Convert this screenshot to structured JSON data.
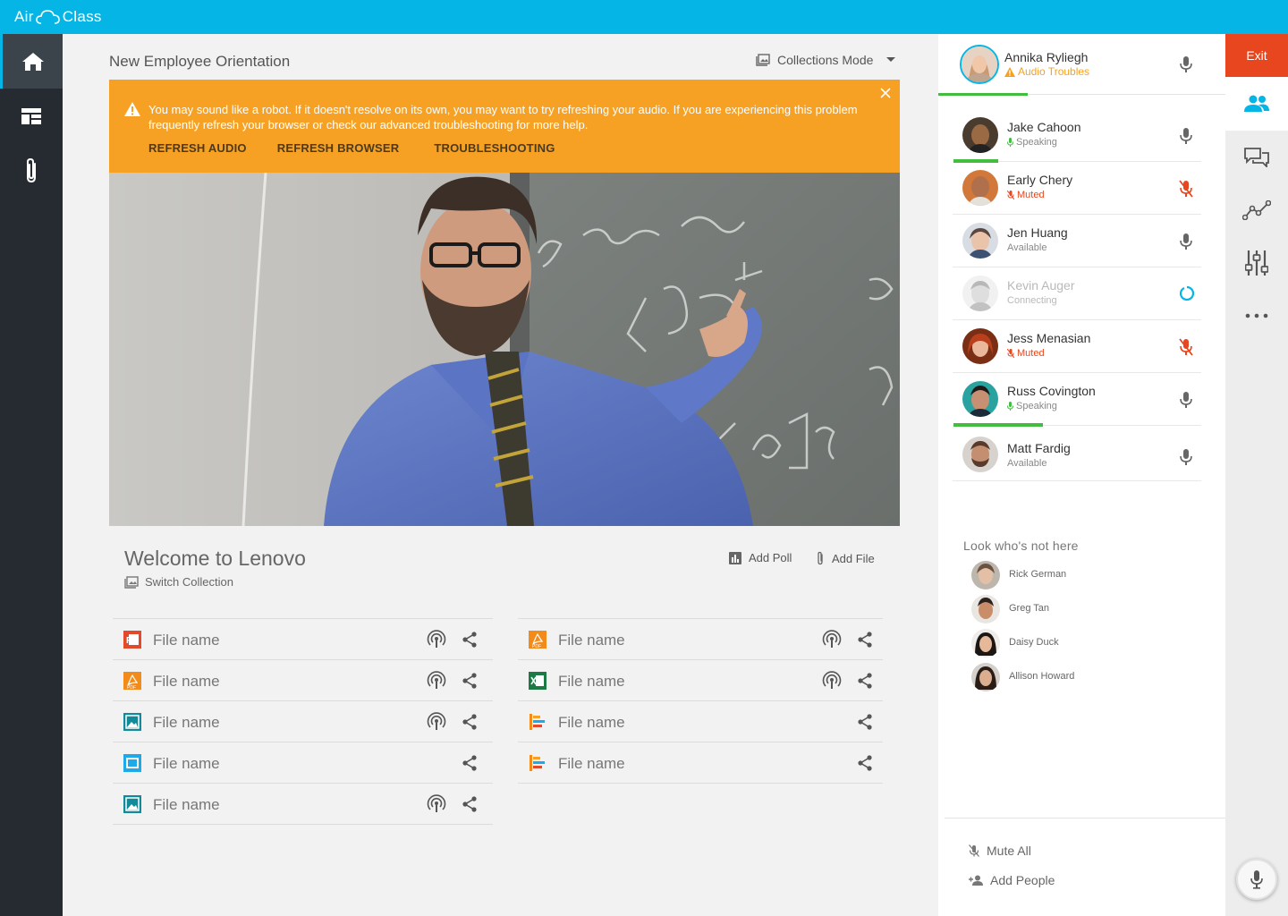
{
  "app": {
    "brand_left": "Air",
    "brand_right": "Class"
  },
  "leftnav": {
    "items": [
      {
        "name": "home",
        "icon": "home-icon",
        "active": true
      },
      {
        "name": "layout",
        "icon": "dashboard-icon",
        "active": false
      },
      {
        "name": "attachments",
        "icon": "paperclip-icon",
        "active": false
      }
    ]
  },
  "session": {
    "title": "New Employee Orientation",
    "mode_label": "Collections Mode"
  },
  "alert": {
    "message": "You may sound like a robot. If it doesn't resolve on its own, you may want to try refreshing your audio. If you are experiencing this problem frequently refresh your browser or check our advanced troubleshooting for more help.",
    "actions": [
      "REFRESH AUDIO",
      "REFRESH BROWSER",
      "TROUBLESHOOTING"
    ],
    "color": "#f6a124"
  },
  "collection": {
    "title": "Welcome to Lenovo",
    "switch_label": "Switch Collection",
    "add_poll_label": "Add Poll",
    "add_file_label": "Add File"
  },
  "files_left": [
    {
      "name": "File name",
      "type": "powerpoint",
      "broadcast": true,
      "share": true
    },
    {
      "name": "File name",
      "type": "pdf",
      "broadcast": true,
      "share": true
    },
    {
      "name": "File name",
      "type": "image",
      "broadcast": true,
      "share": true
    },
    {
      "name": "File name",
      "type": "video",
      "broadcast": false,
      "share": true
    },
    {
      "name": "File name",
      "type": "image",
      "broadcast": true,
      "share": true
    }
  ],
  "files_right": [
    {
      "name": "File name",
      "type": "pdf",
      "broadcast": true,
      "share": true
    },
    {
      "name": "File name",
      "type": "excel",
      "broadcast": true,
      "share": true
    },
    {
      "name": "File name",
      "type": "poll",
      "broadcast": false,
      "share": true
    },
    {
      "name": "File name",
      "type": "poll",
      "broadcast": false,
      "share": true
    }
  ],
  "me": {
    "name": "Annika Ryliegh",
    "status": "Audio Troubles",
    "status_color": "#f6a124"
  },
  "participants": [
    {
      "name": "Jake Cahoon",
      "status": "Speaking",
      "state": "speaking",
      "speak_level": 0.3
    },
    {
      "name": "Early Chery",
      "status": "Muted",
      "state": "muted"
    },
    {
      "name": "Jen Huang",
      "status": "Available",
      "state": "available"
    },
    {
      "name": "Kevin Auger",
      "status": "Connecting",
      "state": "connecting"
    },
    {
      "name": "Jess Menasian",
      "status": "Muted",
      "state": "muted"
    },
    {
      "name": "Russ Covington",
      "status": "Speaking",
      "state": "speaking",
      "speak_level": 0.4
    },
    {
      "name": "Matt Fardig",
      "status": "Available",
      "state": "available"
    }
  ],
  "absent": {
    "title": "Look who's not here",
    "people": [
      "Rick German",
      "Greg Tan",
      "Daisy Duck",
      "Allison Howard"
    ]
  },
  "footer": {
    "mute_all": "Mute All",
    "add_people": "Add People"
  },
  "rail": {
    "exit_label": "Exit",
    "items": [
      "people-icon",
      "chat-icon",
      "analytics-icon",
      "sliders-icon",
      "more-icon"
    ],
    "exit_color": "#e8461e",
    "accent": "#05b5e6"
  }
}
